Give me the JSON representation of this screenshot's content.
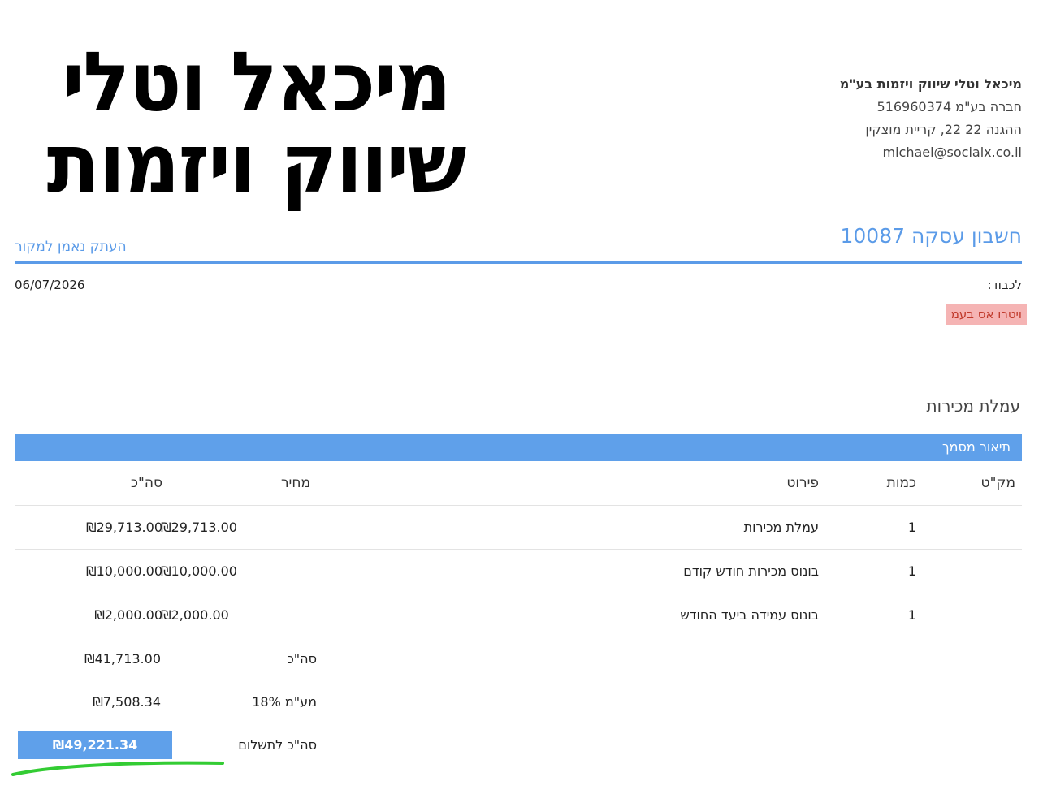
{
  "logo": {
    "line1": "מיכאל וטלי",
    "line2": "שיווק ויזמות"
  },
  "company": {
    "name": "מיכאל וטלי שיווק ויזמות בע\"מ",
    "registration": "חברה בע\"מ 516960374",
    "address": "ההגנה 22 22, קריית מוצקין",
    "email": "michael@socialx.co.il"
  },
  "document": {
    "title": "חשבון עסקה 10087",
    "copy_label": "העתק נאמן למקור",
    "to_label": "לכבוד:",
    "date": "06/07/2026",
    "recipient": "ויטרו אס בעמ"
  },
  "section": {
    "title": "עמלת מכירות",
    "description_header": "תיאור מסמך"
  },
  "table": {
    "headers": {
      "sku": "מק\"ט",
      "qty": "כמות",
      "desc": "פירוט",
      "price": "מחיר",
      "total": "סה\"כ"
    },
    "rows": [
      {
        "sku": "",
        "qty": "1",
        "desc": "עמלת מכירות",
        "price": "₪29,713.00",
        "total": "₪29,713.00"
      },
      {
        "sku": "",
        "qty": "1",
        "desc": "בונוס מכירות חודש קודם",
        "price": "₪10,000.00",
        "total": "₪10,000.00"
      },
      {
        "sku": "",
        "qty": "1",
        "desc": "בונוס עמידה ביעד החודש",
        "price": "₪2,000.00",
        "total": "₪2,000.00"
      }
    ]
  },
  "summary": {
    "subtotal_label": "סה\"כ",
    "subtotal": "₪41,713.00",
    "vat_label": "מע\"מ 18%",
    "vat": "₪7,508.34",
    "grand_label": "סה\"כ לתשלום",
    "grand_total": "₪49,221.34"
  },
  "colors": {
    "accent": "#5b9be8",
    "highlight": "#f5b4b4",
    "marker": "#33cc33"
  }
}
